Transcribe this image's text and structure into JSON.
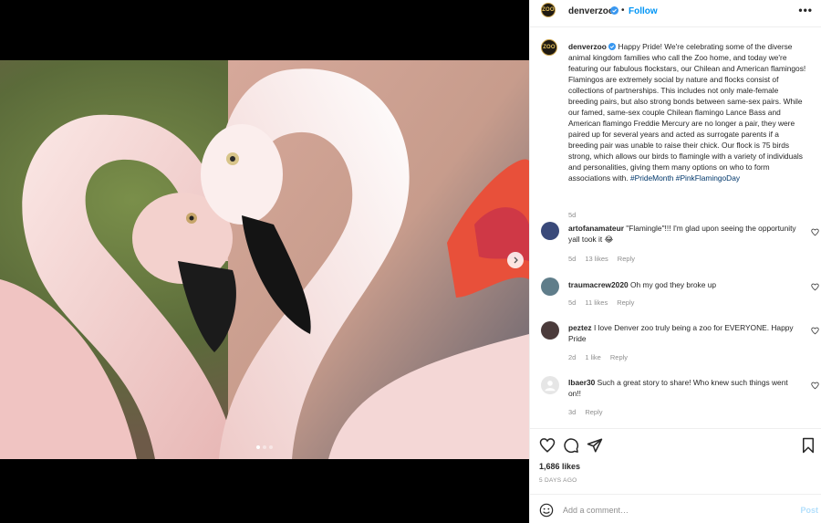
{
  "post": {
    "username": "denverzoo",
    "follow_label": "Follow",
    "separator": "•",
    "more_label": "•••",
    "avatar_text": "ZOO",
    "image_description": "Two pink flamingos forming a heart shape with their necks",
    "carousel": {
      "total": 3,
      "active": 1
    }
  },
  "caption": {
    "username": "denverzoo",
    "text": "Happy Pride! We're celebrating some of the diverse animal kingdom families who call the Zoo home, and today we're featuring our fabulous flockstars, our Chilean and American flamingos! Flamingos are extremely social by nature and flocks consist of collections of partnerships. This includes not only male-female breeding pairs, but also strong bonds between same-sex pairs. While our famed, same-sex couple Chilean flamingo Lance Bass and American flamingo Freddie Mercury are no longer a pair, they were paired up for several years and acted as surrogate parents if a breeding pair was unable to raise their chick. Our flock is 75 birds strong, which allows our birds to flamingle with a variety of individuals and personalities, giving them many options on who to form associations with.",
    "hashtags": "#PrideMonth #PinkFlamingoDay",
    "time": "5d"
  },
  "comments": [
    {
      "username": "artofanamateur",
      "text": "\"Flamingle\"!!! I'm glad upon seeing the opportunity yall took it 😂",
      "time": "5d",
      "likes": "13 likes",
      "reply": "Reply"
    },
    {
      "username": "traumacrew2020",
      "text": "Oh my god they broke up",
      "time": "5d",
      "likes": "11 likes",
      "reply": "Reply"
    },
    {
      "username": "peztez",
      "text": "I love Denver zoo truly being a zoo for EVERYONE. Happy Pride",
      "time": "2d",
      "likes": "1 like",
      "reply": "Reply"
    },
    {
      "username": "lbaer30",
      "text": "Such a great story to share! Who knew such things went on!!",
      "time": "3d",
      "likes": "",
      "reply": "Reply"
    }
  ],
  "stats": {
    "likes": "1,686 likes",
    "time_ago": "5 DAYS AGO"
  },
  "comment_box": {
    "placeholder": "Add a comment…",
    "post_label": "Post"
  },
  "colors": {
    "link_blue": "#0095f6",
    "hashtag_blue": "#00376b",
    "muted": "#8e8e8e"
  }
}
